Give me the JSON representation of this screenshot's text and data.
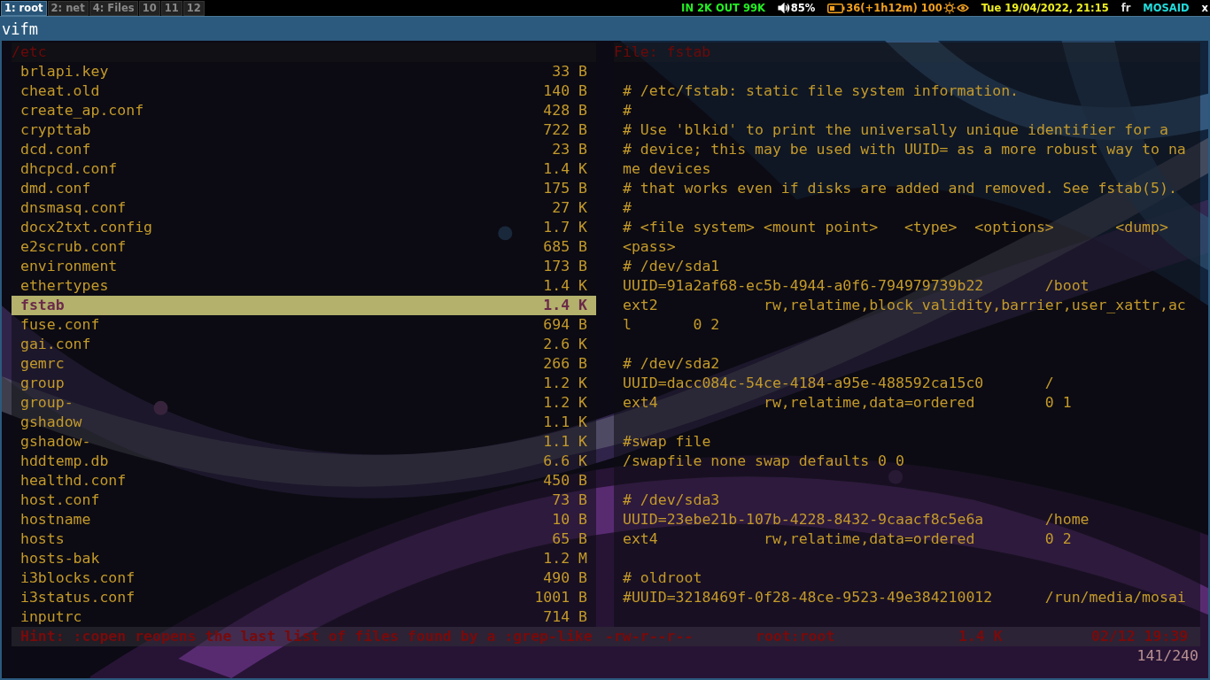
{
  "workspaces": [
    {
      "label": "1: root",
      "selected": true
    },
    {
      "label": "2: net",
      "selected": false
    },
    {
      "label": "4: Files",
      "selected": false
    },
    {
      "label": "10",
      "selected": false
    },
    {
      "label": "11",
      "selected": false
    },
    {
      "label": "12",
      "selected": false
    }
  ],
  "status": {
    "network": "IN 2K OUT 99K",
    "volume": "85%",
    "battery": "36(+1h12m) 100",
    "datetime": "Tue 19/04/2022, 21:15",
    "layout": "fr",
    "user": "MOSAID",
    "extra": "x"
  },
  "window": {
    "title": "vifm"
  },
  "left_pane": {
    "path": "/etc",
    "files": [
      {
        "name": "brlapi.key",
        "size": "33 B",
        "selected": false
      },
      {
        "name": "cheat.old",
        "size": "140 B",
        "selected": false
      },
      {
        "name": "create_ap.conf",
        "size": "428 B",
        "selected": false
      },
      {
        "name": "crypttab",
        "size": "722 B",
        "selected": false
      },
      {
        "name": "dcd.conf",
        "size": "23 B",
        "selected": false
      },
      {
        "name": "dhcpcd.conf",
        "size": "1.4 K",
        "selected": false
      },
      {
        "name": "dmd.conf",
        "size": "175 B",
        "selected": false
      },
      {
        "name": "dnsmasq.conf",
        "size": "27 K",
        "selected": false
      },
      {
        "name": "docx2txt.config",
        "size": "1.7 K",
        "selected": false
      },
      {
        "name": "e2scrub.conf",
        "size": "685 B",
        "selected": false
      },
      {
        "name": "environment",
        "size": "173 B",
        "selected": false
      },
      {
        "name": "ethertypes",
        "size": "1.4 K",
        "selected": false
      },
      {
        "name": "fstab",
        "size": "1.4 K",
        "selected": true
      },
      {
        "name": "fuse.conf",
        "size": "694 B",
        "selected": false
      },
      {
        "name": "gai.conf",
        "size": "2.6 K",
        "selected": false
      },
      {
        "name": "gemrc",
        "size": "266 B",
        "selected": false
      },
      {
        "name": "group",
        "size": "1.2 K",
        "selected": false
      },
      {
        "name": "group-",
        "size": "1.2 K",
        "selected": false
      },
      {
        "name": "gshadow",
        "size": "1.1 K",
        "selected": false
      },
      {
        "name": "gshadow-",
        "size": "1.1 K",
        "selected": false
      },
      {
        "name": "hddtemp.db",
        "size": "6.6 K",
        "selected": false
      },
      {
        "name": "healthd.conf",
        "size": "450 B",
        "selected": false
      },
      {
        "name": "host.conf",
        "size": "73 B",
        "selected": false
      },
      {
        "name": "hostname",
        "size": "10 B",
        "selected": false
      },
      {
        "name": "hosts",
        "size": "65 B",
        "selected": false
      },
      {
        "name": "hosts-bak",
        "size": "1.2 M",
        "selected": false
      },
      {
        "name": "i3blocks.conf",
        "size": "490 B",
        "selected": false
      },
      {
        "name": "i3status.conf",
        "size": "1001 B",
        "selected": false
      },
      {
        "name": "inputrc",
        "size": "714 B",
        "selected": false
      }
    ]
  },
  "right_pane": {
    "header": "File: fstab",
    "blocks": [
      [
        "# /etc/fstab: static file system information.",
        "#",
        "# Use 'blkid' to print the universally unique identifier for a",
        "# device; this may be used with UUID= as a more robust way to na",
        "me devices",
        "# that works even if disks are added and removed. See fstab(5).",
        "#",
        "# <file system> <mount point>   <type>  <options>       <dump>",
        "<pass>",
        "# /dev/sda1",
        "UUID=91a2af68-ec5b-4944-a0f6-794979739b22       /boot",
        "ext2            rw,relatime,block_validity,barrier,user_xattr,ac",
        "l       0 2"
      ],
      [
        "# /dev/sda2",
        "UUID=dacc084c-54ce-4184-a95e-488592ca15c0       /",
        "ext4            rw,relatime,data=ordered        0 1"
      ],
      [
        "#swap file",
        "/swapfile none swap defaults 0 0"
      ],
      [
        "# /dev/sda3",
        "UUID=23ebe21b-107b-4228-8432-9caacf8c5e6a       /home",
        "ext4            rw,relatime,data=ordered        0 2"
      ],
      [
        "# oldroot",
        "#UUID=3218469f-0f28-48ce-9523-49e384210012      /run/media/mosai"
      ]
    ]
  },
  "status_line": {
    "hint": "Hint: :copen reopens the last list of files found by a :grep-like",
    "permissions": "-rw-r--r--",
    "owner": "root:root",
    "size": "1.4 K",
    "date": "02/12 19:39"
  },
  "position": "141/240"
}
